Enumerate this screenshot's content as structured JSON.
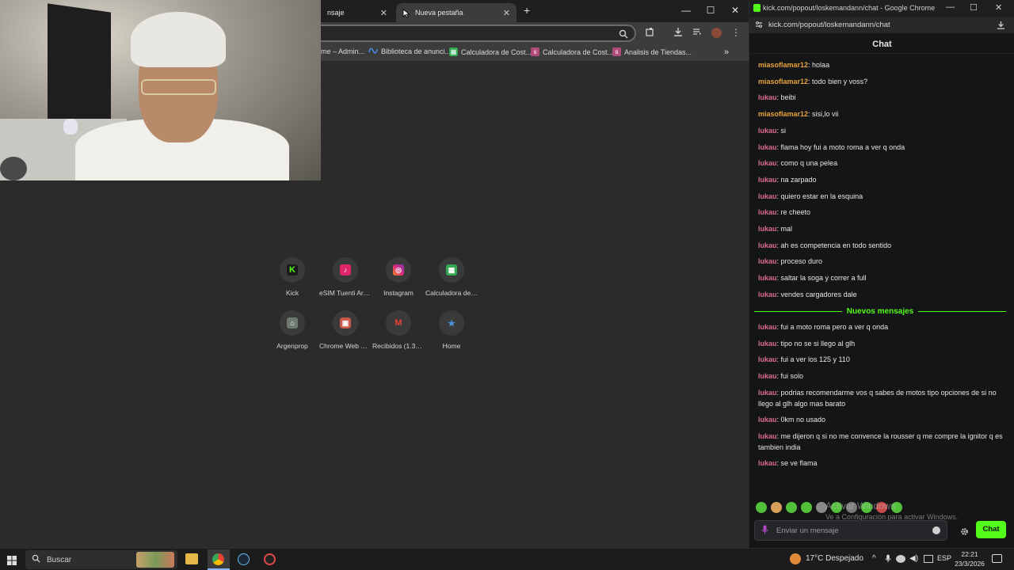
{
  "browser_left": {
    "tabs": [
      {
        "label": "nsaje"
      },
      {
        "label": "Nueva pestaña"
      }
    ],
    "tab_close_glyph": "✕",
    "new_tab_glyph": "+",
    "window_controls": {
      "minimize": "—",
      "maximize": "☐",
      "close": "✕"
    },
    "bookmarks": [
      {
        "label": "me – Admin...",
        "icon": "page-icon",
        "color": "#5a5a5a"
      },
      {
        "label": "Biblioteca de anunci...",
        "icon": "meta-icon",
        "color": "#1877f2"
      },
      {
        "label": "Calculadora de Cost...",
        "icon": "sheets-icon",
        "color": "#34a853"
      },
      {
        "label": "Calculadora de Cost...",
        "icon": "sk-icon",
        "color": "#b04a7a"
      },
      {
        "label": "Analisis de Tiendas...",
        "icon": "sk-icon",
        "color": "#b04a7a"
      }
    ],
    "bookmarks_overflow": "»",
    "shortcuts": [
      {
        "label": "Kick",
        "icon": "kick-icon",
        "glyph": "K",
        "color": "#53fc18"
      },
      {
        "label": "eSIM Tuenti Arg...",
        "icon": "tuenti-icon",
        "glyph": "♪",
        "color": "#e0246a"
      },
      {
        "label": "Instagram",
        "icon": "instagram-icon",
        "glyph": "◎",
        "color": "#d6249f"
      },
      {
        "label": "Calculadora de ...",
        "icon": "sheets-icon",
        "glyph": "▦",
        "color": "#34a853"
      },
      {
        "label": "Argenprop",
        "icon": "argenprop-icon",
        "glyph": "⌂",
        "color": "#7a8a7a"
      },
      {
        "label": "Chrome Web St...",
        "icon": "webstore-icon",
        "glyph": "▣",
        "color": "#d04a3a"
      },
      {
        "label": "Recibidos (1.334)",
        "icon": "gmail-icon",
        "glyph": "M",
        "color": "#ea4335"
      },
      {
        "label": "Home",
        "icon": "home-icon",
        "glyph": "★",
        "color": "#4a90d9"
      }
    ]
  },
  "chat_window": {
    "title": "kick.com/popout/loskemandann/chat - Google Chrome",
    "url": "kick.com/popout/loskemandann/chat",
    "header": "Chat",
    "messages_before": [
      {
        "user": "miasoflamar12",
        "text": ": holaa",
        "tone": "orange"
      },
      {
        "user": "miasoflamar12",
        "text": ": todo bien y voss?",
        "tone": "orange"
      },
      {
        "user": "lukau",
        "text": ": beibi",
        "tone": "pink"
      },
      {
        "user": "miasoflamar12",
        "text": ": sisi,lo vii",
        "tone": "orange"
      },
      {
        "user": "lukau",
        "text": ": si",
        "tone": "pink"
      },
      {
        "user": "lukau",
        "text": ": flama hoy fui a moto roma a ver q onda",
        "tone": "pink"
      },
      {
        "user": "lukau",
        "text": ": como q una pelea",
        "tone": "pink"
      },
      {
        "user": "lukau",
        "text": ": na zarpado",
        "tone": "pink"
      },
      {
        "user": "lukau",
        "text": ": quiero estar en la esquina",
        "tone": "pink"
      },
      {
        "user": "lukau",
        "text": ": re cheeto",
        "tone": "pink"
      },
      {
        "user": "lukau",
        "text": ": mal",
        "tone": "pink"
      },
      {
        "user": "lukau",
        "text": ": ah es competencia en todo sentido",
        "tone": "pink"
      },
      {
        "user": "lukau",
        "text": ": proceso duro",
        "tone": "pink"
      },
      {
        "user": "lukau",
        "text": ": saltar la soga y correr a full",
        "tone": "pink"
      },
      {
        "user": "lukau",
        "text": ": vendes cargadores dale",
        "tone": "pink"
      }
    ],
    "new_messages_label": "Nuevos mensajes",
    "messages_after": [
      {
        "user": "lukau",
        "text": ": fui a moto roma pero a ver q onda",
        "tone": "pink"
      },
      {
        "user": "lukau",
        "text": ": tipo no se si llego al glh",
        "tone": "pink"
      },
      {
        "user": "lukau",
        "text": ": fui a ver los 125 y 110",
        "tone": "pink"
      },
      {
        "user": "lukau",
        "text": ": fui solo",
        "tone": "pink"
      },
      {
        "user": "lukau",
        "text": ": podrias recomendarme vos q sabes de motos tipo opciones de si no llego al glh algo mas barato",
        "tone": "pink"
      },
      {
        "user": "lukau",
        "text": ": 0km no usado",
        "tone": "pink"
      },
      {
        "user": "lukau",
        "text": ": me dijeron q si no me convence la rousser q me compre la ignitor q es tambien india",
        "tone": "pink"
      },
      {
        "user": "lukau",
        "text": ": se ve flama",
        "tone": "pink"
      }
    ],
    "input_placeholder": "Enviar un mensaje",
    "send_label": "Chat",
    "activation_title": "Activar Windows",
    "activation_sub": "Ve a Configuración para activar Windows.",
    "accent": "#53fc18"
  },
  "taskbar": {
    "search_placeholder": "Buscar",
    "weather": "17°C  Despejado",
    "language": "ESP",
    "time": "22:21",
    "date": "23/3/2026"
  }
}
